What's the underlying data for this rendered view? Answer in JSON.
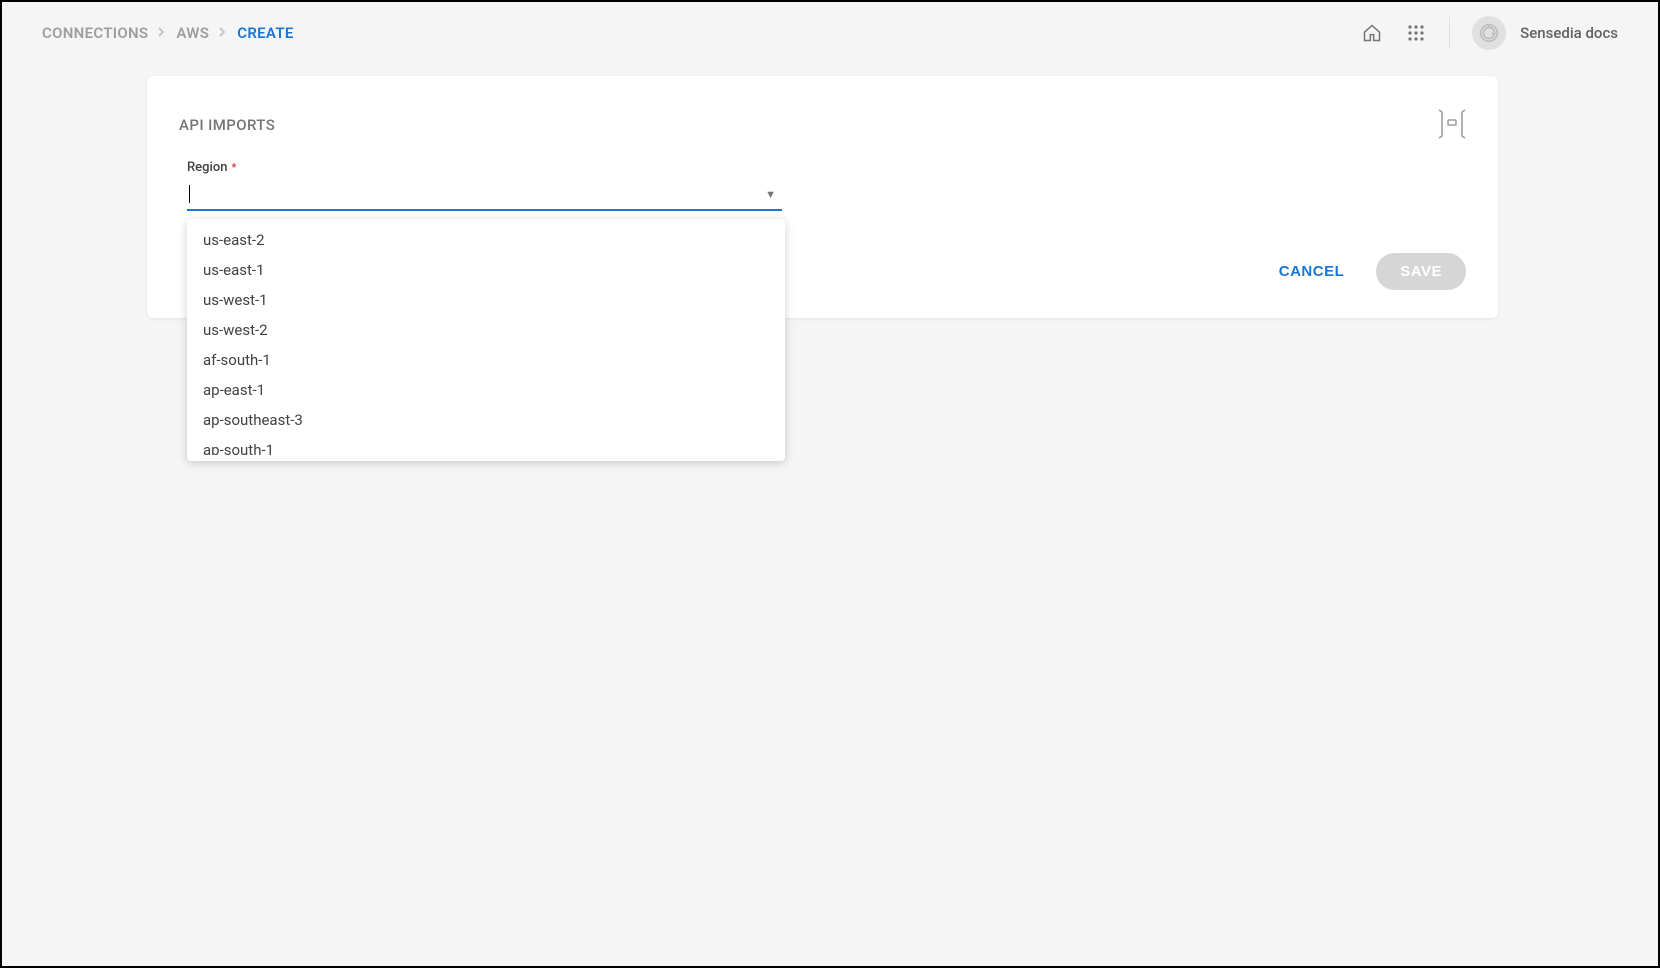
{
  "breadcrumb": {
    "items": [
      "CONNECTIONS",
      "AWS",
      "Create"
    ],
    "active_index": 2
  },
  "user": {
    "name": "Sensedia docs"
  },
  "card": {
    "title": "API IMPORTS",
    "field_label": "Region",
    "region_value": "",
    "region_options": [
      "us-east-2",
      "us-east-1",
      "us-west-1",
      "us-west-2",
      "af-south-1",
      "ap-east-1",
      "ap-southeast-3",
      "ap-south-1"
    ],
    "cancel_label": "CANCEL",
    "save_label": "SAVE"
  }
}
